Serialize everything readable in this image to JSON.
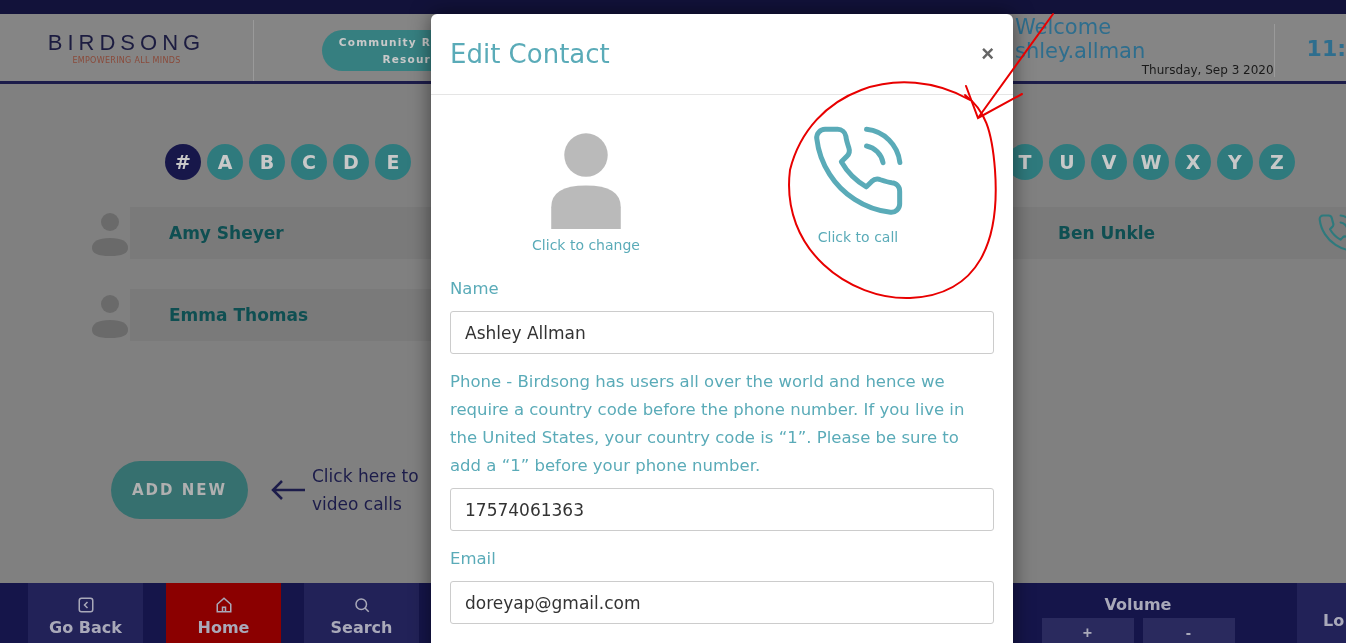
{
  "header": {
    "logo": {
      "name": "BIRDSONG",
      "tagline": "EMPOWERING ALL MINDS"
    },
    "community_button": "Community R\nResour",
    "welcome": "Welcome",
    "username": "shley.allman",
    "date": "Thursday, Sep 3 2020",
    "time": "11:"
  },
  "alphabet_left": [
    {
      "label": "#",
      "selected": true
    },
    {
      "label": "A",
      "selected": false
    },
    {
      "label": "B",
      "selected": false
    },
    {
      "label": "C",
      "selected": false
    },
    {
      "label": "D",
      "selected": false
    },
    {
      "label": "E",
      "selected": false
    }
  ],
  "alphabet_right": [
    {
      "label": "T",
      "selected": false
    },
    {
      "label": "U",
      "selected": false
    },
    {
      "label": "V",
      "selected": false
    },
    {
      "label": "W",
      "selected": false
    },
    {
      "label": "X",
      "selected": false
    },
    {
      "label": "Y",
      "selected": false
    },
    {
      "label": "Z",
      "selected": false
    }
  ],
  "contacts_left": [
    {
      "name": "Amy Sheyer"
    },
    {
      "name": "Emma Thomas"
    }
  ],
  "contacts_right": [
    {
      "name": "Ben Unkle"
    }
  ],
  "add_new": "ADD NEW",
  "hint": "Click here to\nvideo calls",
  "nav_left": [
    {
      "label": "Go Back",
      "kind": "back",
      "selected": false
    },
    {
      "label": "Home",
      "kind": "home",
      "selected": true
    },
    {
      "label": "Search",
      "kind": "search",
      "selected": false
    }
  ],
  "volume": {
    "label": "Volume",
    "buttons": [
      "+",
      "-"
    ]
  },
  "nav_right": {
    "label": "Lo"
  },
  "modal": {
    "title": "Edit Contact",
    "close": "×",
    "avatar_caption": "Click to change",
    "call_caption": "Click to call",
    "fields": [
      {
        "label": "Name",
        "value": "Ashley Allman"
      },
      {
        "label": "Phone - Birdsong has users all over the world and hence we require a country code before the phone number. If you live in the United States, your country code is “1”. Please be sure to add a “1” before your phone number.",
        "value": "17574061363"
      },
      {
        "label": "Email",
        "value": "doreyap@gmail.com"
      }
    ]
  }
}
